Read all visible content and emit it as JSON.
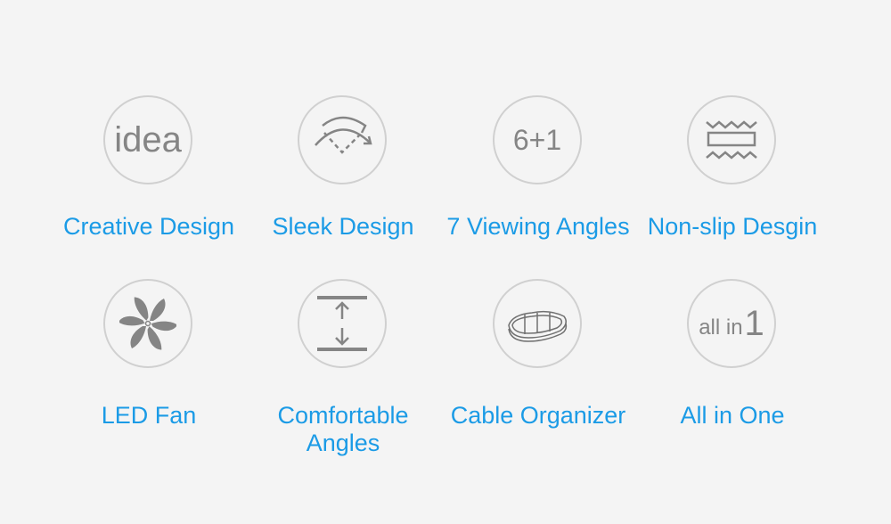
{
  "features": [
    {
      "label": "Creative Design",
      "icon": "idea-icon",
      "icon_text": "idea"
    },
    {
      "label": "Sleek Design",
      "icon": "curved-arc-arrow-icon"
    },
    {
      "label": "7 Viewing Angles",
      "icon": "six-plus-one-icon",
      "icon_text": "6+1"
    },
    {
      "label": "Non-slip Desgin",
      "icon": "non-slip-pad-icon"
    },
    {
      "label": "LED Fan",
      "icon": "fan-icon"
    },
    {
      "label": "Comfortable Angles",
      "label_line1": "Comfortable",
      "label_line2": "Angles",
      "icon": "height-adjust-arrows-icon"
    },
    {
      "label": "Cable Organizer",
      "icon": "cable-organizer-icon"
    },
    {
      "label": "All in One",
      "icon": "all-in-one-icon",
      "icon_text": "all in",
      "icon_digit": "1"
    }
  ],
  "colors": {
    "label": "#1b9be6",
    "icon": "#858585",
    "circle": "#d0d0d0",
    "background": "#f4f4f4"
  }
}
